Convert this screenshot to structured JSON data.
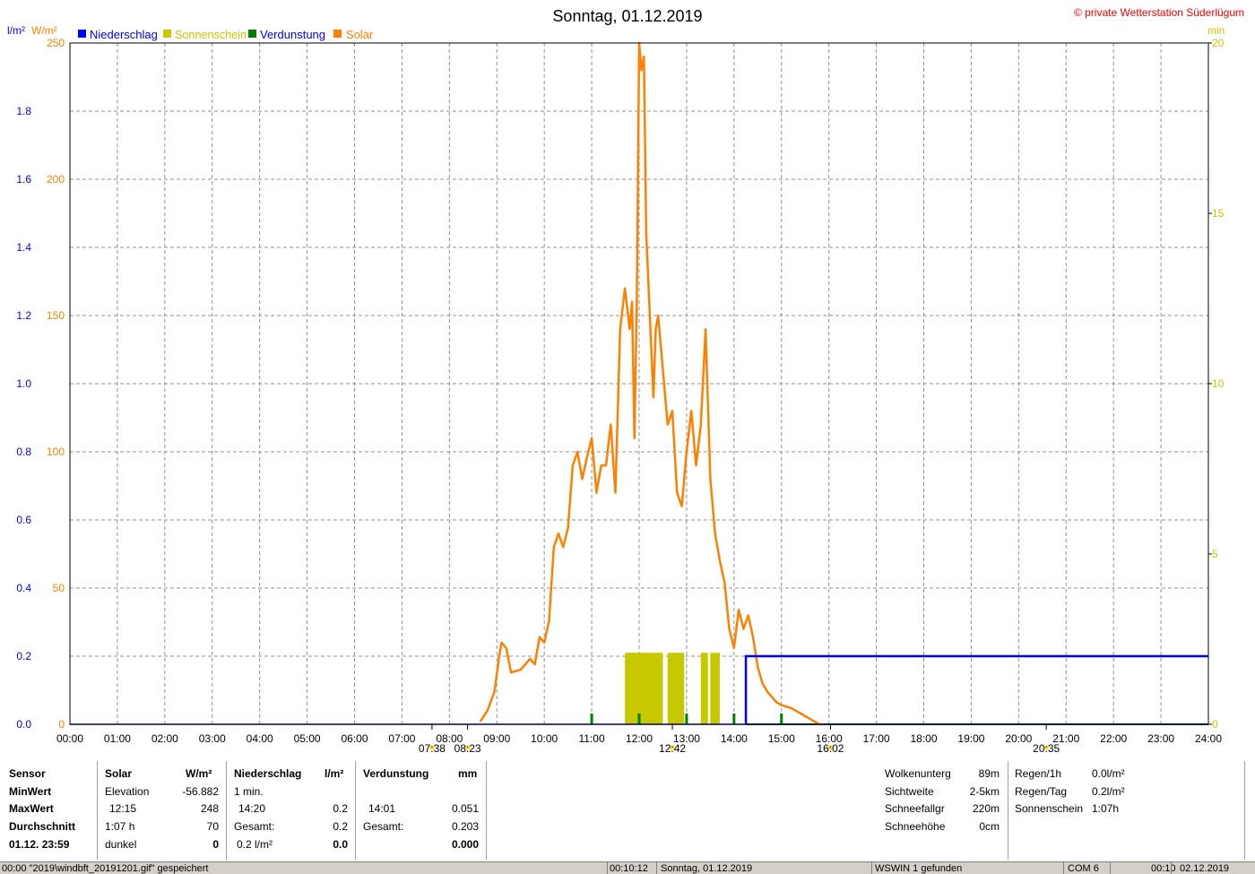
{
  "chart_data": {
    "type": "line",
    "title": "Sonntag, 01.12.2019",
    "copyright": "© private Wetterstation Süderlügum",
    "units": {
      "left_precip": "l/m²",
      "left_solar": "W/m²",
      "right": "min"
    },
    "legend": [
      {
        "name": "Niederschlag",
        "color": "#0000ff"
      },
      {
        "name": "Sonnenschein",
        "color": "#c8c800"
      },
      {
        "name": "Verdunstung",
        "color": "#008000"
      },
      {
        "name": "Solar",
        "color": "#ff8000"
      }
    ],
    "x_range_h": [
      0,
      24
    ],
    "x_ticks": [
      "00:00",
      "01:00",
      "02:00",
      "03:00",
      "04:00",
      "05:00",
      "06:00",
      "07:00",
      "08:00",
      "09:00",
      "10:00",
      "11:00",
      "12:00",
      "13:00",
      "14:00",
      "15:00",
      "16:00",
      "17:00",
      "18:00",
      "19:00",
      "20:00",
      "21:00",
      "22:00",
      "23:00",
      "24:00"
    ],
    "precip_axis": {
      "ylim": [
        0,
        2.0
      ],
      "ticks": [
        "0.0",
        "0.2",
        "0.4",
        "0.6",
        "0.8",
        "1.0",
        "1.2",
        "1.4",
        "1.6",
        "1.8"
      ],
      "values": [
        0,
        0.2,
        0.4,
        0.6,
        0.8,
        1.0,
        1.2,
        1.4,
        1.6,
        1.8
      ]
    },
    "solar_axis": {
      "ylim": [
        0,
        250
      ],
      "ticks": [
        "0",
        "50",
        "100",
        "150",
        "200",
        "250"
      ],
      "values": [
        0,
        50,
        100,
        150,
        200,
        250
      ]
    },
    "minutes_axis": {
      "ylim": [
        0,
        20
      ],
      "ticks": [
        "0",
        "5",
        "10",
        "15",
        "20"
      ],
      "values": [
        0,
        5,
        10,
        15,
        20
      ]
    },
    "solar_series": {
      "name": "Solar",
      "x": [
        8.65,
        8.8,
        8.95,
        9.05,
        9.1,
        9.2,
        9.3,
        9.5,
        9.7,
        9.8,
        9.9,
        10.0,
        10.1,
        10.2,
        10.3,
        10.4,
        10.5,
        10.6,
        10.7,
        10.8,
        10.9,
        11.0,
        11.1,
        11.2,
        11.3,
        11.4,
        11.5,
        11.6,
        11.7,
        11.8,
        11.85,
        11.9,
        11.95,
        12.0,
        12.05,
        12.1,
        12.15,
        12.2,
        12.25,
        12.3,
        12.35,
        12.4,
        12.5,
        12.6,
        12.7,
        12.8,
        12.9,
        13.0,
        13.1,
        13.2,
        13.3,
        13.4,
        13.5,
        13.6,
        13.7,
        13.8,
        13.9,
        14.0,
        14.1,
        14.2,
        14.3,
        14.4,
        14.5,
        14.6,
        14.7,
        14.8,
        14.9,
        15.0,
        15.2,
        15.4,
        15.6,
        15.8,
        15.9
      ],
      "y": [
        1,
        5,
        12,
        25,
        30,
        28,
        19,
        20,
        24,
        22,
        32,
        30,
        38,
        65,
        70,
        65,
        72,
        95,
        100,
        90,
        98,
        105,
        85,
        95,
        95,
        110,
        85,
        145,
        160,
        145,
        155,
        105,
        155,
        250,
        240,
        245,
        180,
        160,
        140,
        120,
        145,
        150,
        130,
        110,
        115,
        85,
        80,
        100,
        115,
        95,
        110,
        145,
        90,
        70,
        60,
        52,
        35,
        28,
        42,
        35,
        40,
        32,
        21,
        15,
        12,
        10,
        8,
        7,
        6,
        4,
        2,
        0,
        0
      ]
    },
    "sunshine_blocks": [
      [
        11.7,
        12.5
      ],
      [
        12.6,
        12.95
      ],
      [
        13.3,
        13.45
      ],
      [
        13.5,
        13.7
      ]
    ],
    "sunshine_block_min": 2.1,
    "precip_series": {
      "name": "Niederschlag",
      "step_time": 14.25,
      "before": 0.0,
      "after": 0.2
    },
    "evaporation_ticks": [
      11.0,
      12.0,
      13.0,
      14.0,
      15.0
    ],
    "time_markers": [
      {
        "label": "07:38",
        "h": 7.633
      },
      {
        "label": "08:23",
        "h": 8.383
      },
      {
        "label": "12:42",
        "h": 12.7
      },
      {
        "label": "16:02",
        "h": 16.033
      },
      {
        "label": "20:35",
        "h": 20.583
      }
    ]
  },
  "panel": {
    "row_labels": [
      "Sensor",
      "MinWert",
      "MaxWert",
      "Durchschnitt",
      "01.12. 23:59"
    ],
    "solar": {
      "header": "Solar",
      "unit": "W/m²",
      "rows": [
        {
          "label": "Elevation",
          "value": "-56.882"
        },
        {
          "label": "12:15",
          "value": "248"
        },
        {
          "label": "1:07 h",
          "value": "70"
        },
        {
          "label": "dunkel",
          "value": "0"
        }
      ]
    },
    "precip": {
      "header": "Niederschlag",
      "unit": "l/m²",
      "rows": [
        {
          "label": "1 min.",
          "value": ""
        },
        {
          "label": "14:20",
          "value": "0.2"
        },
        {
          "label": "Gesamt:",
          "value": "0.2"
        },
        {
          "label": "0.2 l/m²",
          "value": "0.0"
        }
      ]
    },
    "evap": {
      "header": "Verdunstung",
      "unit": "mm",
      "rows": [
        {
          "label": "",
          "value": ""
        },
        {
          "label": "14:01",
          "value": "0.051"
        },
        {
          "label": "Gesamt:",
          "value": "0.203"
        },
        {
          "label": "",
          "value": "0.000"
        }
      ]
    },
    "weather": [
      {
        "label": "Wolkenunterg",
        "value": "89m"
      },
      {
        "label": "Sichtweite",
        "value": "2-5km"
      },
      {
        "label": "Schneefallgr",
        "value": "220m"
      },
      {
        "label": "Schneehöhe",
        "value": "0cm"
      }
    ],
    "rain": [
      {
        "label": "Regen/1h",
        "value": "0.0l/m²"
      },
      {
        "label": "Regen/Tag",
        "value": "0.2l/m²"
      },
      {
        "label": "Sonnenschein",
        "value": "1:07h"
      }
    ]
  },
  "status": {
    "message": "00:00  \"2019\\windbft_20191201.gif\"  gespeichert",
    "time": "00:10:12",
    "date_label": "Sonntag, 01.12.2019",
    "wswin": "WSWIN 1 gefunden",
    "port": "COM 6",
    "clock": "00:10",
    "date": "02.12.2019"
  }
}
